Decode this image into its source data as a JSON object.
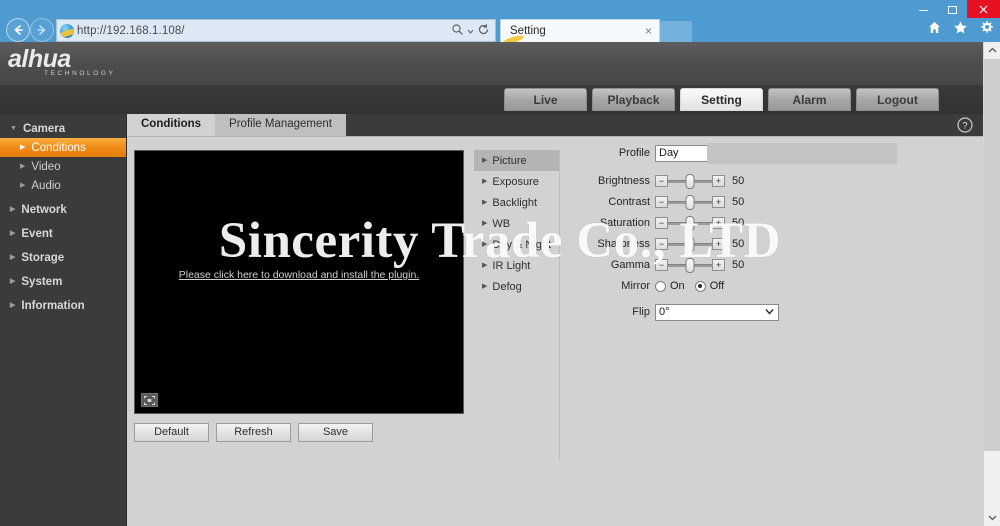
{
  "browser": {
    "address_url": "http://192.168.1.108/",
    "address_host": "192.168.1.108",
    "address_scheme": "http://",
    "address_path": "/",
    "tab_title": "Setting",
    "tab_close_label": "×",
    "search_icon": "search-icon",
    "refresh_icon": "refresh-icon",
    "back_icon": "back-arrow-icon",
    "forward_icon": "forward-arrow-icon",
    "home_icon": "home-icon",
    "favorites_icon": "star-icon",
    "tools_icon": "gear-icon",
    "window_minimize": "—",
    "window_maximize": "❐",
    "window_close": "✕"
  },
  "header": {
    "brand": "alhua",
    "brand_sub": "TECHNOLOGY",
    "nav": [
      {
        "label": "Live",
        "active": false
      },
      {
        "label": "Playback",
        "active": false
      },
      {
        "label": "Setting",
        "active": true
      },
      {
        "label": "Alarm",
        "active": false
      },
      {
        "label": "Logout",
        "active": false
      }
    ]
  },
  "sidebar": {
    "items": [
      {
        "label": "Camera",
        "level": 1,
        "expanded": true,
        "selected": false
      },
      {
        "label": "Conditions",
        "level": 2,
        "expanded": false,
        "selected": true
      },
      {
        "label": "Video",
        "level": 2,
        "expanded": false,
        "selected": false
      },
      {
        "label": "Audio",
        "level": 2,
        "expanded": false,
        "selected": false
      },
      {
        "label": "Network",
        "level": 1,
        "expanded": false,
        "selected": false
      },
      {
        "label": "Event",
        "level": 1,
        "expanded": false,
        "selected": false
      },
      {
        "label": "Storage",
        "level": 1,
        "expanded": false,
        "selected": false
      },
      {
        "label": "System",
        "level": 1,
        "expanded": false,
        "selected": false
      },
      {
        "label": "Information",
        "level": 1,
        "expanded": false,
        "selected": false
      }
    ]
  },
  "content": {
    "tabs": [
      {
        "label": "Conditions",
        "active": true
      },
      {
        "label": "Profile Management",
        "active": false
      }
    ],
    "help_icon": "question-mark-icon",
    "video": {
      "plugin_message": "Please click here to download and install the plugin.",
      "snapshot_icon": "fullscreen-icon"
    },
    "buttons": [
      {
        "label": "Default"
      },
      {
        "label": "Refresh"
      },
      {
        "label": "Save"
      }
    ],
    "submenu": [
      {
        "label": "Picture",
        "active": true
      },
      {
        "label": "Exposure",
        "active": false
      },
      {
        "label": "Backlight",
        "active": false
      },
      {
        "label": "WB",
        "active": false
      },
      {
        "label": "Day & Night",
        "active": false
      },
      {
        "label": "IR Light",
        "active": false
      },
      {
        "label": "Defog",
        "active": false
      }
    ],
    "profile": {
      "label": "Profile",
      "value": "Day"
    },
    "sliders": [
      {
        "label": "Brightness",
        "value": "50",
        "percent": 50
      },
      {
        "label": "Contrast",
        "value": "50",
        "percent": 50
      },
      {
        "label": "Saturation",
        "value": "50",
        "percent": 50
      },
      {
        "label": "Sharpness",
        "value": "50",
        "percent": 50
      },
      {
        "label": "Gamma",
        "value": "50",
        "percent": 50
      }
    ],
    "stepper": {
      "minus": "−",
      "plus": "+"
    },
    "mirror": {
      "label": "Mirror",
      "on_label": "On",
      "off_label": "Off",
      "selected": "Off"
    },
    "flip": {
      "label": "Flip",
      "value": "0°"
    }
  },
  "watermark": {
    "text": "Sincerity Trade Co., LTD"
  },
  "colors": {
    "accent_orange": "#f08a17",
    "chrome_blue": "#4e9bd1",
    "close_red": "#e81123",
    "panel_gray": "#d2d2d2",
    "sidebar_dark": "#3b3b3b"
  }
}
